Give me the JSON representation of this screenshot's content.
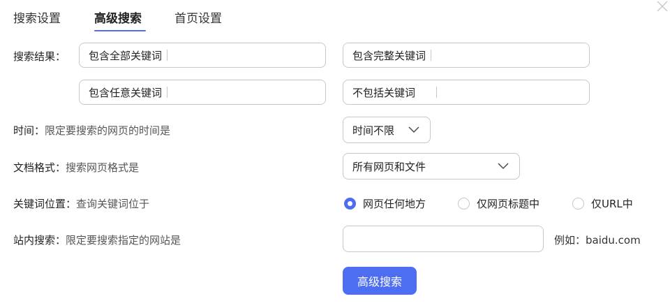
{
  "tabs": [
    {
      "label": "搜索设置",
      "active": false
    },
    {
      "label": "高级搜索",
      "active": true
    },
    {
      "label": "首页设置",
      "active": false
    }
  ],
  "accent_color": "#4e6ef2",
  "search_result": {
    "label": "搜索结果：",
    "all_keywords": "包含全部关键词",
    "exact_phrase": "包含完整关键词",
    "any_keywords": "包含任意关键词",
    "exclude_keywords": "不包括关键词"
  },
  "time": {
    "label": "时间：",
    "desc": "限定要搜索的网页的时间是",
    "selected": "时间不限"
  },
  "doc_format": {
    "label": "文档格式：",
    "desc": "搜索网页格式是",
    "selected": "所有网页和文件"
  },
  "keyword_position": {
    "label": "关键词位置：",
    "desc": "查询关键词位于",
    "options": [
      {
        "label": "网页任何地方",
        "checked": true
      },
      {
        "label": "仅网页标题中",
        "checked": false
      },
      {
        "label": "仅URL中",
        "checked": false
      }
    ]
  },
  "site_search": {
    "label": "站内搜索：",
    "desc": "限定要搜索指定的网站是",
    "value": "",
    "example": "例如：baidu.com"
  },
  "submit_label": "高级搜索",
  "icons": {
    "close": "close-icon",
    "chevron": "chevron-down-icon"
  }
}
